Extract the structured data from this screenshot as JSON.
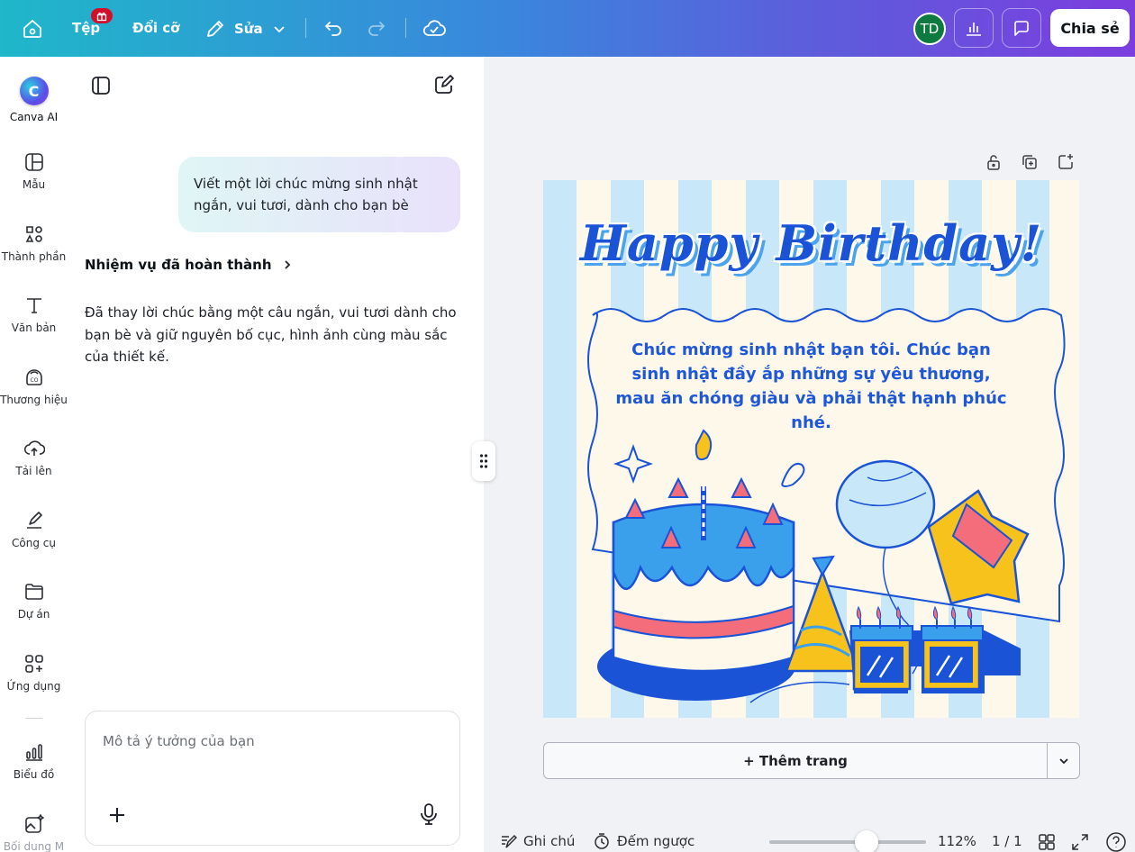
{
  "topbar": {
    "file_label": "Tệp",
    "resize_label": "Đổi cỡ",
    "edit_label": "Sửa",
    "avatar_initials": "TD",
    "share_label": "Chia sẻ"
  },
  "sidebar": {
    "items": [
      {
        "label": "Canva AI"
      },
      {
        "label": "Mẫu"
      },
      {
        "label": "Thành phần"
      },
      {
        "label": "Văn bản"
      },
      {
        "label": "Thương hiệu"
      },
      {
        "label": "Tải lên"
      },
      {
        "label": "Công cụ"
      },
      {
        "label": "Dự án"
      },
      {
        "label": "Ứng dụng"
      },
      {
        "label": "Biểu đồ"
      },
      {
        "label": "Bối dung M"
      }
    ]
  },
  "chat": {
    "user_message": "Viết một lời chúc mừng sinh nhật ngắn, vui tươi, dành cho bạn bè",
    "task_status": "Nhiệm vụ đã hoàn thành",
    "assistant_reply": "Đã thay lời chúc bằng một câu ngắn, vui tươi dành cho bạn bè và giữ nguyên bố cục, hình ảnh cùng màu sắc của thiết kế.",
    "input_placeholder": "Mô tả ý tưởng của bạn"
  },
  "design": {
    "title": "Happy Birthday!",
    "wish_text": "Chúc mừng sinh nhật bạn tôi. Chúc bạn sinh nhật đầy ắp những sự yêu thương, mau ăn chóng giàu và phải thật hạnh phúc nhé."
  },
  "canvas": {
    "add_page_label": "+ Thêm trang"
  },
  "bottombar": {
    "notes_label": "Ghi chú",
    "timer_label": "Đếm ngược",
    "zoom_level": "112%",
    "zoom_fraction": 0.62,
    "page_indicator": "1 / 1"
  },
  "colors": {
    "brand_gradient_start": "#1fb7c9",
    "brand_gradient_end": "#7c3ddf",
    "design_blue": "#1a53d6",
    "stripe_blue": "#c8e7f8",
    "stripe_cream": "#fdf8ea"
  }
}
